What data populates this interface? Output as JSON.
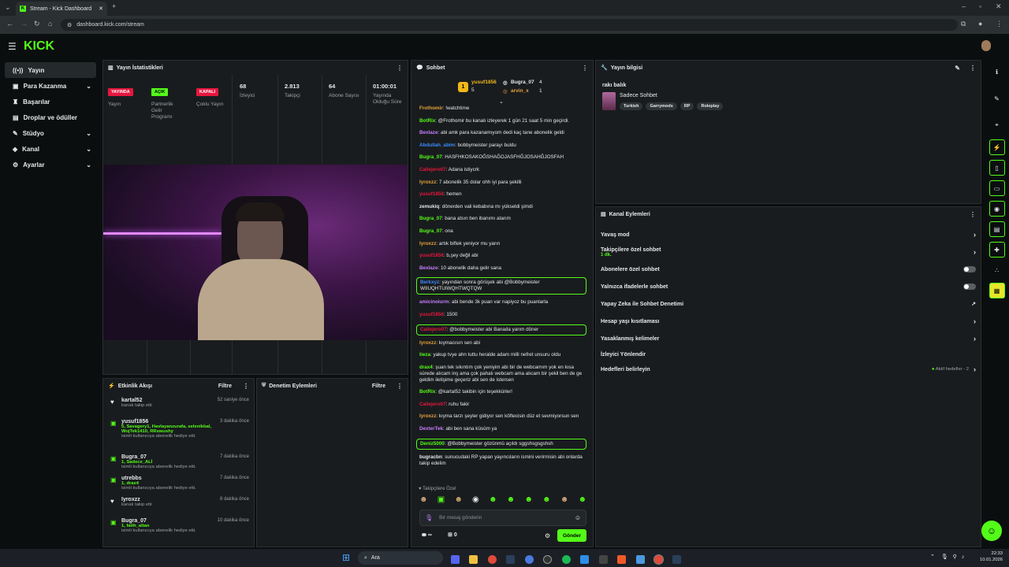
{
  "browser": {
    "tab_title": "Stream - Kick Dashboard",
    "url": "dashboard.kick.com/stream"
  },
  "app": {
    "logo": "KICK"
  },
  "sidebar": {
    "items": [
      {
        "label": "Yayın",
        "icon": "broadcast-icon",
        "active": true
      },
      {
        "label": "Para Kazanma",
        "icon": "money-icon",
        "chevron": true
      },
      {
        "label": "Başarılar",
        "icon": "trophy-icon"
      },
      {
        "label": "Droplar ve ödüller",
        "icon": "gift-icon"
      },
      {
        "label": "Stüdyo",
        "icon": "studio-icon",
        "chevron": true
      },
      {
        "label": "Kanal",
        "icon": "channel-icon",
        "chevron": true
      },
      {
        "label": "Ayarlar",
        "icon": "gear-icon",
        "chevron": true
      }
    ]
  },
  "stats": {
    "title": "Yayın İstatistikleri",
    "cells": [
      {
        "badge": "YAYINDA",
        "badge_color": "#e5173f",
        "label": "Yayın"
      },
      {
        "badge": "AÇIK",
        "badge_color": "#53fc18",
        "label": "Partnerlik Gelir Programı"
      },
      {
        "badge": "KAPALI",
        "badge_color": "#e5173f",
        "label": "Çoklu Yayın"
      },
      {
        "value": "68",
        "label": "İzleyici"
      },
      {
        "value": "2.813",
        "label": "Takipçi"
      },
      {
        "value": "64",
        "label": "Abone Sayısı"
      },
      {
        "value": "01:00:01",
        "label": "Yayında Olduğu Süre"
      }
    ]
  },
  "chat": {
    "title": "Sohbet",
    "leaders": {
      "first": {
        "name": "yusuf1856",
        "count": "5"
      },
      "second": {
        "name": "Bugra_07",
        "count": "4"
      },
      "third": {
        "name": "arvin_x",
        "count": "1"
      }
    },
    "messages": [
      {
        "user": "Frothomir",
        "color": "#e6a23c",
        "text": "!watchtime"
      },
      {
        "user": "BotRix",
        "color": "#53fc18",
        "text": "@Frothomir bu kanalı izleyerek 1 gün 21 saat 5 min geçirdi."
      },
      {
        "user": "Bexlaze",
        "color": "#c77dff",
        "text": "abi amk para kazanamıyom dedi kaç tane abonelik geldi"
      },
      {
        "user": "Abdullah_abim",
        "color": "#3d8bfd",
        "text": "bobbymeister parayı buldu"
      },
      {
        "user": "Bugra_07",
        "color": "#53fc18",
        "text": "HASFHKOSAKOĞSHAĞOJASFHĞJOSAHĞJOSFAH"
      },
      {
        "user": "Caliejero07",
        "color": "#e5173f",
        "text": "Adana istiycrk"
      },
      {
        "user": "Iyroxzz",
        "color": "#e6a23c",
        "text": "7 abonelik 35 dolar ohh iyi para şekilli"
      },
      {
        "user": "yusuf1856",
        "color": "#e5173f",
        "text": "hemen"
      },
      {
        "user": "zemukiq",
        "color": "#e7e9ea",
        "text": "dönerden vali kebabına mı yükseldi şimdi"
      },
      {
        "user": "Bugra_07",
        "color": "#53fc18",
        "text": "bana atsın ben ibanımı atarım"
      },
      {
        "user": "Bugra_07",
        "color": "#53fc18",
        "text": "ona"
      },
      {
        "user": "Iyroxzz",
        "color": "#e6a23c",
        "text": "artık biftek yeniyor mu yarın"
      },
      {
        "user": "yusuf1856",
        "color": "#e5173f",
        "text": "b,şey değil abi"
      },
      {
        "user": "Bexlaze",
        "color": "#c77dff",
        "text": "10 abonelik daha gelir sana"
      },
      {
        "user": "Berkxyz",
        "color": "#3d8bfd",
        "text": "yayından sonra görüşek abi @Bobbymeister WIIUQHTUIWQHTWQTQW",
        "hl": true
      },
      {
        "user": "amicinoiurm",
        "color": "#c77dff",
        "text": "abi bende 3k puan var napiyoz bu puanlarla"
      },
      {
        "user": "yusuf1856",
        "color": "#e5173f",
        "text": "1500"
      },
      {
        "user": "Caliejero07",
        "color": "#e5173f",
        "text": "@bobbymeister abi Banada yarım döner",
        "hl": true
      },
      {
        "user": "Iyroxzz",
        "color": "#e6a23c",
        "text": "kıymacısın sen abi"
      },
      {
        "user": "tieza",
        "color": "#53fc18",
        "text": "yakup tvye ahn tuttu heralde adam milli nefret unsuru oldu"
      },
      {
        "user": "drax4",
        "color": "#53fc18",
        "text": "şuan tek sıkıntım çok yeniyim abi bir de webcamım yok en kısa sürede alıcam inş ama çok pahalı webcam ama alıcam bir şekil ben de ge geldim iletişime geçeriz abi sen de istersen"
      },
      {
        "user": "BotRix",
        "color": "#53fc18",
        "text": "@kartal52 takibin için teşekkürler!"
      },
      {
        "user": "Caliejero07",
        "color": "#e5173f",
        "text": "ruhu fakir"
      },
      {
        "user": "Iyroxzz",
        "color": "#e6a23c",
        "text": "kıyma tarzı şeyler gidiyor sen köftecisin düz et sevmiyorsun sen"
      },
      {
        "user": "DexterTek",
        "color": "#c77dff",
        "text": "abi ben sana küsüm ya"
      },
      {
        "user": "Deniz5000",
        "color": "#53fc18",
        "text": "@Bobbymeister gözünmü açıldı sggshsgsgshsh",
        "hl": true
      },
      {
        "user": "bugracbn",
        "color": "#e7e9ea",
        "text": "sunucudaki RP yapan yayıncıların ismini verirmisin abi onlarda takip edelim"
      }
    ],
    "followers_only_label": "Takipçilere Özel",
    "input_placeholder": "Bir mesaj gönderin",
    "points": "∞",
    "gift_count": "0",
    "send_label": "Gönder"
  },
  "events": {
    "title": "Etkinlik Akışı",
    "filter_label": "Filtre",
    "items": [
      {
        "name": "kartal52",
        "time": "52 saniye önce",
        "detail": "",
        "sub": "kanalı takip etti",
        "icon": "heart-icon"
      },
      {
        "name": "yusuf1856",
        "time": "3 dakika önce",
        "detail": "5, Savagery1, Havlayanzurafa, selenikbal, WojTek1410, RRswushy",
        "sub": "isimli kullanıcıya abonelik hediye etti.",
        "icon": "gift-icon"
      },
      {
        "name": "Bugra_07",
        "time": "7 dakika önce",
        "detail": "1, Sadece_ALİ",
        "sub": "isimli kullanıcıya abonelik hediye etti.",
        "icon": "gift-icon"
      },
      {
        "name": "utrebbs",
        "time": "7 dakika önce",
        "detail": "1, drax4",
        "sub": "isimli kullanıcıya abonelik hediye etti.",
        "icon": "gift-icon"
      },
      {
        "name": "Iyroxzz",
        "time": "8 dakika önce",
        "detail": "",
        "sub": "kanalı takip etti",
        "icon": "heart-icon"
      },
      {
        "name": "Bugra_07",
        "time": "10 dakika önce",
        "detail": "1, fatih_altan",
        "sub": "isimli kullanıcıya abonelik hediye etti.",
        "icon": "gift-icon"
      }
    ]
  },
  "moderation": {
    "title": "Denetim Eylemleri",
    "filter_label": "Filtre"
  },
  "stream_info": {
    "title": "Yayın bilgisi",
    "stream_title": "rakı balık",
    "category": "Sadece Sohbet",
    "tags": [
      "Turkish",
      "Garrymods",
      "RP",
      "Roleplay"
    ]
  },
  "channel_actions": {
    "title": "Kanal Eylemleri",
    "items": [
      {
        "label": "Yavaş mod",
        "control": "arrow"
      },
      {
        "label": "Takipçilere özel sohbet",
        "sub": "1 dk.",
        "control": "arrow"
      },
      {
        "label": "Abonelere özel sohbet",
        "control": "toggle"
      },
      {
        "label": "Yalnızca ifadelerle sohbet",
        "control": "toggle"
      },
      {
        "label": "Yapay Zeka ile Sohbet Denetimi",
        "control": "external"
      },
      {
        "label": "Hesap yaşı kısıtlaması",
        "control": "arrow"
      },
      {
        "label": "Yasaklanmış kelimeler",
        "control": "arrow"
      },
      {
        "label": "İzleyici Yönlendir",
        "control": "none"
      },
      {
        "label": "Hedefleri belirleyin",
        "control": "arrow",
        "status": "Aktif hedefler - 2"
      }
    ]
  },
  "taskbar": {
    "search_label": "Ara",
    "time": "22:33",
    "date": "10.01.2026"
  },
  "colors": {
    "accent": "#53fc18",
    "live": "#e5173f",
    "panel": "#191c1e"
  }
}
